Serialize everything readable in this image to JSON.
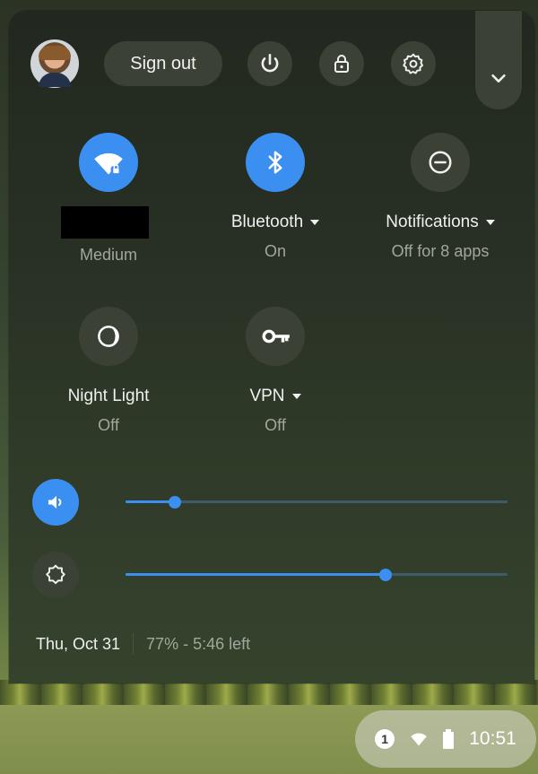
{
  "header": {
    "signout_label": "Sign out",
    "avatar_icon": "user-avatar",
    "power_icon": "power-icon",
    "lock_icon": "lock-icon",
    "settings_icon": "gear-icon",
    "expand_icon": "chevron-down-icon"
  },
  "tiles": {
    "wifi": {
      "label": "",
      "status": "Medium",
      "icon": "wifi-lock-icon",
      "active": true
    },
    "bluetooth": {
      "label": "Bluetooth",
      "status": "On",
      "icon": "bluetooth-icon",
      "active": true
    },
    "notifications": {
      "label": "Notifications",
      "status": "Off for 8 apps",
      "icon": "do-not-disturb-icon",
      "active": false
    },
    "night_light": {
      "label": "Night Light",
      "status": "Off",
      "icon": "night-light-icon",
      "active": false
    },
    "vpn": {
      "label": "VPN",
      "status": "Off",
      "icon": "vpn-key-icon",
      "active": false
    }
  },
  "sliders": {
    "volume": {
      "icon": "volume-icon",
      "level": 0.13
    },
    "brightness": {
      "icon": "brightness-icon",
      "level": 0.68
    }
  },
  "footer": {
    "date": "Thu, Oct 31",
    "battery": "77% - 5:46 left"
  },
  "shelf": {
    "notification_count": "1",
    "clock": "10:51"
  },
  "colors": {
    "accent": "#3b8ff0",
    "panel": "#283024",
    "button": "#3b4235"
  }
}
